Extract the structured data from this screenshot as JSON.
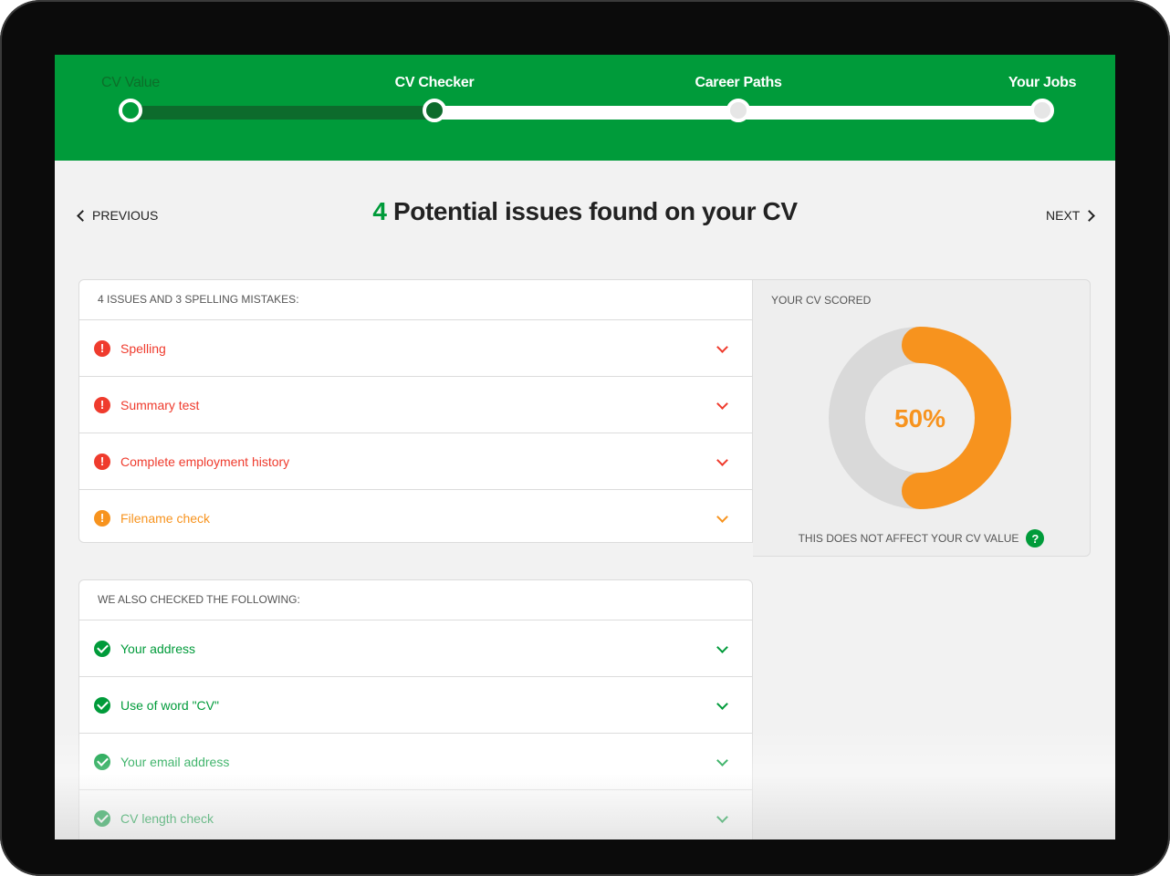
{
  "progress": {
    "steps": [
      {
        "label": "CV Value",
        "state": "done"
      },
      {
        "label": "CV Checker",
        "state": "current"
      },
      {
        "label": "Career Paths",
        "state": "future"
      },
      {
        "label": "Your Jobs",
        "state": "future"
      }
    ]
  },
  "nav": {
    "previous_label": "PREVIOUS",
    "next_label": "NEXT"
  },
  "title": {
    "count": "4",
    "text": "Potential issues found on your CV"
  },
  "issues": {
    "header": "4 ISSUES AND 3 SPELLING MISTAKES:",
    "items": [
      {
        "label": "Spelling",
        "severity": "error",
        "color": "#ef3b2d"
      },
      {
        "label": "Summary test",
        "severity": "error",
        "color": "#ef3b2d"
      },
      {
        "label": "Complete employment history",
        "severity": "error",
        "color": "#ef3b2d"
      },
      {
        "label": "Filename check",
        "severity": "warning",
        "color": "#f7931e"
      }
    ]
  },
  "checked": {
    "header": "WE ALSO CHECKED THE FOLLOWING:",
    "items": [
      {
        "label": "Your address",
        "color": "#009b3a"
      },
      {
        "label": "Use of word \"CV\"",
        "color": "#009b3a"
      },
      {
        "label": "Your email address",
        "color": "#009b3a"
      },
      {
        "label": "CV length check",
        "color": "#009b3a"
      }
    ]
  },
  "score": {
    "header": "YOUR CV SCORED",
    "value_label": "50%",
    "fraction": 0.5,
    "note": "THIS DOES NOT AFFECT YOUR CV VALUE",
    "help_icon": "?",
    "fill_color": "#f7931e",
    "track_color": "#d9d9d9"
  },
  "colors": {
    "brand": "#009b3a",
    "brand_dark": "#0d6b2c"
  }
}
